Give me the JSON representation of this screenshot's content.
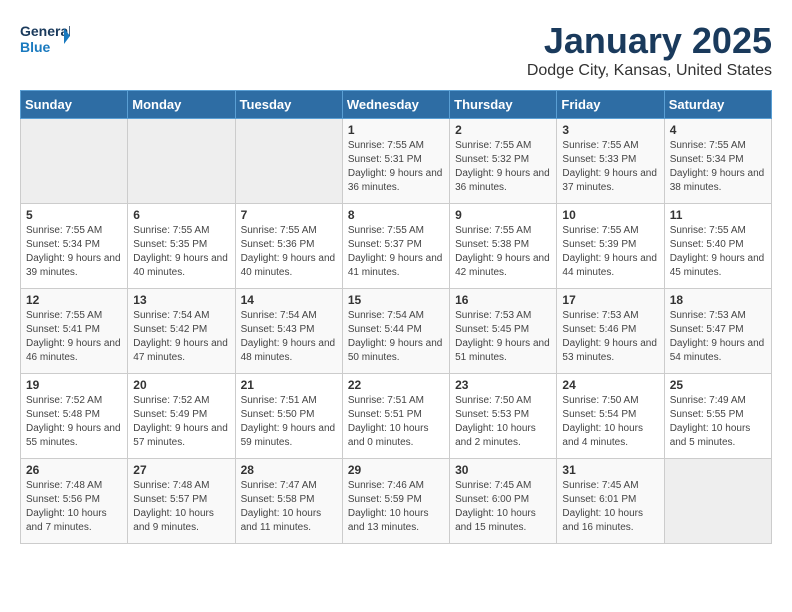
{
  "logo": {
    "line1": "General",
    "line2": "Blue"
  },
  "title": "January 2025",
  "subtitle": "Dodge City, Kansas, United States",
  "weekdays": [
    "Sunday",
    "Monday",
    "Tuesday",
    "Wednesday",
    "Thursday",
    "Friday",
    "Saturday"
  ],
  "weeks": [
    [
      {
        "day": "",
        "empty": true
      },
      {
        "day": "",
        "empty": true
      },
      {
        "day": "",
        "empty": true
      },
      {
        "day": "1",
        "sunrise": "7:55 AM",
        "sunset": "5:31 PM",
        "daylight": "9 hours and 36 minutes."
      },
      {
        "day": "2",
        "sunrise": "7:55 AM",
        "sunset": "5:32 PM",
        "daylight": "9 hours and 36 minutes."
      },
      {
        "day": "3",
        "sunrise": "7:55 AM",
        "sunset": "5:33 PM",
        "daylight": "9 hours and 37 minutes."
      },
      {
        "day": "4",
        "sunrise": "7:55 AM",
        "sunset": "5:34 PM",
        "daylight": "9 hours and 38 minutes."
      }
    ],
    [
      {
        "day": "5",
        "sunrise": "7:55 AM",
        "sunset": "5:34 PM",
        "daylight": "9 hours and 39 minutes."
      },
      {
        "day": "6",
        "sunrise": "7:55 AM",
        "sunset": "5:35 PM",
        "daylight": "9 hours and 40 minutes."
      },
      {
        "day": "7",
        "sunrise": "7:55 AM",
        "sunset": "5:36 PM",
        "daylight": "9 hours and 40 minutes."
      },
      {
        "day": "8",
        "sunrise": "7:55 AM",
        "sunset": "5:37 PM",
        "daylight": "9 hours and 41 minutes."
      },
      {
        "day": "9",
        "sunrise": "7:55 AM",
        "sunset": "5:38 PM",
        "daylight": "9 hours and 42 minutes."
      },
      {
        "day": "10",
        "sunrise": "7:55 AM",
        "sunset": "5:39 PM",
        "daylight": "9 hours and 44 minutes."
      },
      {
        "day": "11",
        "sunrise": "7:55 AM",
        "sunset": "5:40 PM",
        "daylight": "9 hours and 45 minutes."
      }
    ],
    [
      {
        "day": "12",
        "sunrise": "7:55 AM",
        "sunset": "5:41 PM",
        "daylight": "9 hours and 46 minutes."
      },
      {
        "day": "13",
        "sunrise": "7:54 AM",
        "sunset": "5:42 PM",
        "daylight": "9 hours and 47 minutes."
      },
      {
        "day": "14",
        "sunrise": "7:54 AM",
        "sunset": "5:43 PM",
        "daylight": "9 hours and 48 minutes."
      },
      {
        "day": "15",
        "sunrise": "7:54 AM",
        "sunset": "5:44 PM",
        "daylight": "9 hours and 50 minutes."
      },
      {
        "day": "16",
        "sunrise": "7:53 AM",
        "sunset": "5:45 PM",
        "daylight": "9 hours and 51 minutes."
      },
      {
        "day": "17",
        "sunrise": "7:53 AM",
        "sunset": "5:46 PM",
        "daylight": "9 hours and 53 minutes."
      },
      {
        "day": "18",
        "sunrise": "7:53 AM",
        "sunset": "5:47 PM",
        "daylight": "9 hours and 54 minutes."
      }
    ],
    [
      {
        "day": "19",
        "sunrise": "7:52 AM",
        "sunset": "5:48 PM",
        "daylight": "9 hours and 55 minutes."
      },
      {
        "day": "20",
        "sunrise": "7:52 AM",
        "sunset": "5:49 PM",
        "daylight": "9 hours and 57 minutes."
      },
      {
        "day": "21",
        "sunrise": "7:51 AM",
        "sunset": "5:50 PM",
        "daylight": "9 hours and 59 minutes."
      },
      {
        "day": "22",
        "sunrise": "7:51 AM",
        "sunset": "5:51 PM",
        "daylight": "10 hours and 0 minutes."
      },
      {
        "day": "23",
        "sunrise": "7:50 AM",
        "sunset": "5:53 PM",
        "daylight": "10 hours and 2 minutes."
      },
      {
        "day": "24",
        "sunrise": "7:50 AM",
        "sunset": "5:54 PM",
        "daylight": "10 hours and 4 minutes."
      },
      {
        "day": "25",
        "sunrise": "7:49 AM",
        "sunset": "5:55 PM",
        "daylight": "10 hours and 5 minutes."
      }
    ],
    [
      {
        "day": "26",
        "sunrise": "7:48 AM",
        "sunset": "5:56 PM",
        "daylight": "10 hours and 7 minutes."
      },
      {
        "day": "27",
        "sunrise": "7:48 AM",
        "sunset": "5:57 PM",
        "daylight": "10 hours and 9 minutes."
      },
      {
        "day": "28",
        "sunrise": "7:47 AM",
        "sunset": "5:58 PM",
        "daylight": "10 hours and 11 minutes."
      },
      {
        "day": "29",
        "sunrise": "7:46 AM",
        "sunset": "5:59 PM",
        "daylight": "10 hours and 13 minutes."
      },
      {
        "day": "30",
        "sunrise": "7:45 AM",
        "sunset": "6:00 PM",
        "daylight": "10 hours and 15 minutes."
      },
      {
        "day": "31",
        "sunrise": "7:45 AM",
        "sunset": "6:01 PM",
        "daylight": "10 hours and 16 minutes."
      },
      {
        "day": "",
        "empty": true
      }
    ]
  ]
}
